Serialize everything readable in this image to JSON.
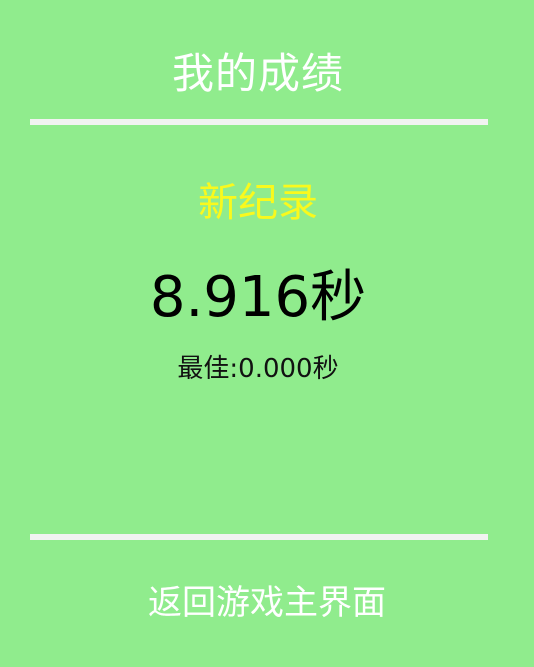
{
  "page": {
    "title": "我的成绩",
    "new_record_label": "新纪录",
    "current_time": "8.916秒",
    "best_time": "最佳:0.000秒",
    "return_button_label": "返回游戏主界面"
  },
  "colors": {
    "background": "#90ec8d",
    "title": "#ffffff",
    "new_record": "#f9f91d",
    "current_time": "#000000",
    "best_time": "#111111",
    "divider": "#f1f3f1"
  }
}
